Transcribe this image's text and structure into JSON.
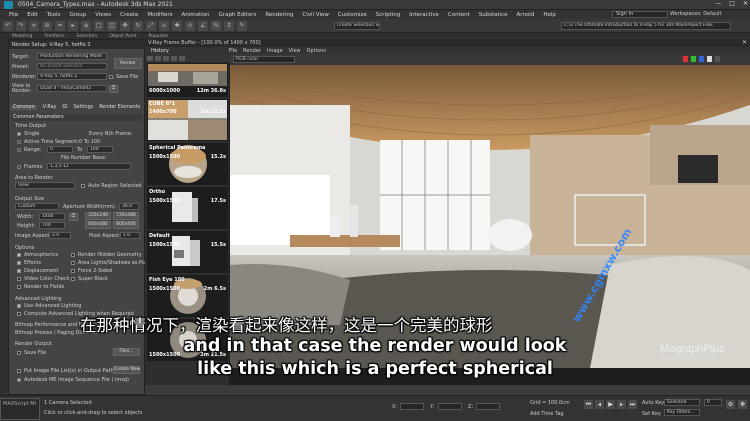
{
  "window": {
    "title": "0504_Camera_Types.max - Autodesk 3ds Max 2021",
    "controls": [
      "—",
      "□",
      "✕"
    ]
  },
  "menubar": {
    "items": [
      "File",
      "Edit",
      "Tools",
      "Group",
      "Views",
      "Create",
      "Modifiers",
      "Animation",
      "Graph Editors",
      "Rendering",
      "Civil View",
      "Customize",
      "Scripting",
      "Interactive",
      "Content",
      "Substance",
      "Arnold",
      "Help"
    ],
    "signin": "Sign In",
    "workspace": "Workspaces:  Default"
  },
  "toolbar": {
    "selection_set": "Create Selection Se",
    "project_path": "C:\\3 The Ultimate Introduction to V-Ray 5 for 3ds Max\\Project Files"
  },
  "ribbon": {
    "tabs": [
      "Modeling",
      "Freeform",
      "Selection",
      "Object Paint",
      "Populate"
    ]
  },
  "render_setup": {
    "title": "Render Setup: V-Ray 5, hotfix 2",
    "target_label": "Target:",
    "target_value": "Production Rendering Mode",
    "preset_label": "Preset:",
    "preset_value": "No preset selected",
    "renderer_label": "Renderer:",
    "renderer_value": "V-Ray 5, hotfix 2",
    "save_file_label": "Save File",
    "view_label": "View to Render:",
    "view_value": "Quad 4 - VRayCam002",
    "render_button": "Render",
    "tabs": [
      "Common",
      "V-Ray",
      "GI",
      "Settings",
      "Render Elements"
    ],
    "common_parameters": "Common Parameters",
    "time_output": "Time Output",
    "single": "Single",
    "every_nth": "Every Nth Frame:",
    "active_segment": "Active Time Segment:",
    "active_segment_value": "0 To 100",
    "range": "Range:",
    "range_from": "0",
    "range_to_label": "To",
    "range_to": "100",
    "file_number_base": "File Number Base:",
    "frames": "Frames",
    "frames_value": "1,3,5-12",
    "area_to_render": "Area to Render",
    "area_value": "View",
    "auto_region": "Auto Region Selected",
    "output_size": "Output Size",
    "output_size_value": "Custom",
    "aperture": "Aperture Width(mm):",
    "aperture_value": "36.0",
    "width_label": "Width:",
    "width_value": "1400",
    "height_label": "Height:",
    "height_value": "700",
    "presets": [
      "320x240",
      "720x486",
      "640x480",
      "800x600"
    ],
    "image_aspect": "Image Aspect:",
    "image_aspect_value": "2.0",
    "pixel_aspect": "Pixel Aspect:",
    "pixel_aspect_value": "1.0",
    "options": "Options",
    "atmospherics": "Atmospherics",
    "render_hidden": "Render Hidden Geometry",
    "effects": "Effects",
    "area_lights": "Area Lights/Shadows as Points",
    "displacement": "Displacement",
    "force_2sided": "Force 2-Sided",
    "video_color_check": "Video Color Check",
    "super_black": "Super Black",
    "render_to_fields": "Render to Fields",
    "advanced_lighting": "Advanced Lighting",
    "use_advanced_lighting": "Use Advanced Lighting",
    "compute_advanced": "Compute Advanced Lighting when Required",
    "bitmap_perf": "Bitmap Performance and Memory Options",
    "bitmap_proxies": "Bitmap Proxies / Paging Disabled",
    "render_output": "Render Output",
    "save_file": "Save File",
    "files_button": "Files...",
    "put_image_file": "Put Image File List(s) in Output Path(s)",
    "create_now": "Create Now",
    "autodesk_me": "Autodesk ME Image Sequence File (.imsq)"
  },
  "frame_buffer": {
    "title": "V-Ray Frame Buffer - [100.0% of 1400 x 700]",
    "menu": [
      "File",
      "Render",
      "Image",
      "View",
      "Options"
    ],
    "history_label": "History",
    "color_space": "RGB color",
    "history": [
      {
        "name": "",
        "res": "6000x1000",
        "time": "12m 36.8s"
      },
      {
        "name": "CUBE 6*1",
        "res": "1400x700",
        "time": "2m 22.1s"
      },
      {
        "name": "Spherical Panorama",
        "res": "1500x1500",
        "time": "15.2s"
      },
      {
        "name": "Ortho",
        "res": "1500x1500",
        "time": "17.5s"
      },
      {
        "name": "Default",
        "res": "1500x1500",
        "time": "15.5s"
      },
      {
        "name": "Fish Eye 180",
        "res": "1500x1500",
        "time": "2m 6.5s"
      },
      {
        "name": "",
        "res": "1500x1500",
        "time": "2m 21.5s"
      }
    ]
  },
  "subtitles": {
    "chinese": "在那种情况下，渲染看起来像这样，这是一个完美的球形",
    "english_line1": "and in that case the render would look",
    "english_line2": "like this which is a perfect spherical"
  },
  "watermark": "www.cgmxw.com",
  "brand": {
    "name": "MographPlus",
    "url": "MOGRAPHPLUS.COM"
  },
  "statusbar": {
    "maxscript": "MAXScript Mi",
    "selection": "1 Camera Selected",
    "prompt": "Click or click-and-drag to select objects",
    "x_label": "X:",
    "y_label": "Y:",
    "z_label": "Z:",
    "grid": "Grid = 100.0cm",
    "add_time_tag": "Add Time Tag",
    "auto_key": "Auto Key",
    "set_key": "Set Key",
    "selected": "Selected",
    "key_filters": "Key Filters...",
    "frame": "0"
  },
  "colors": {
    "accent": "#1c8bb0",
    "watermark": "#2f86ff"
  }
}
